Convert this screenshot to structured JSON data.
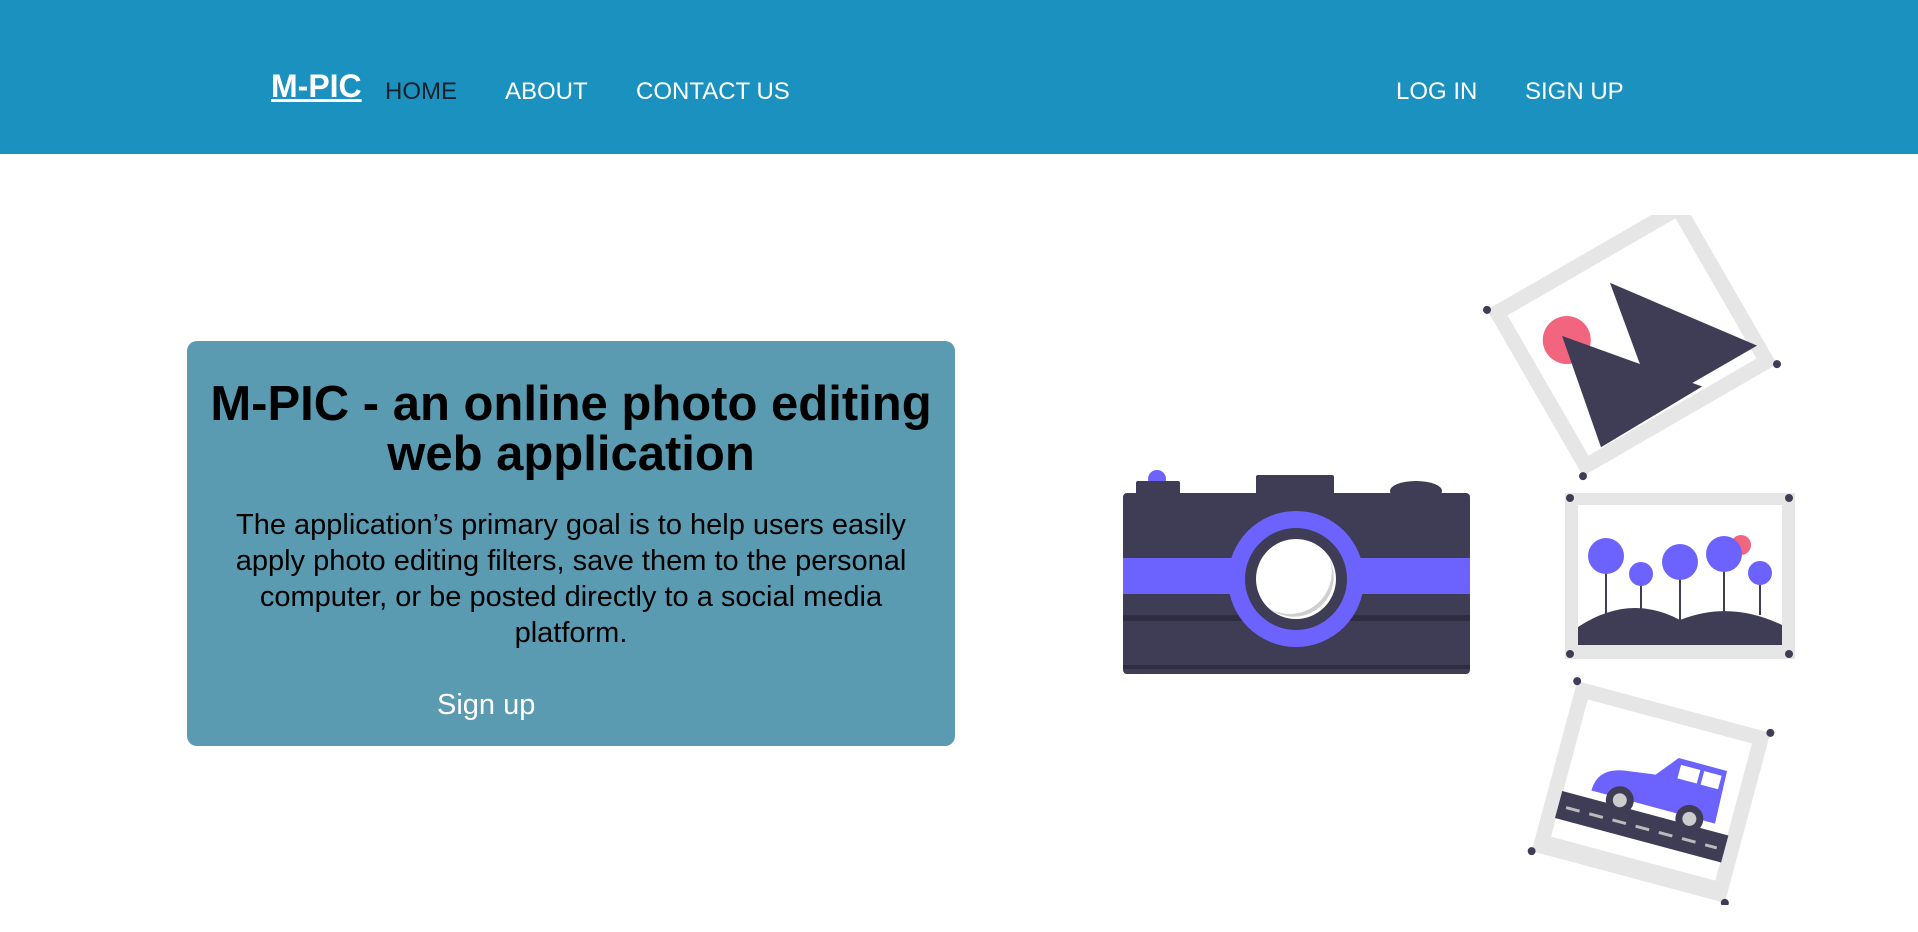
{
  "navbar": {
    "brand": "M-PIC",
    "links": [
      "HOME",
      "ABOUT",
      "CONTACT US"
    ],
    "auth": [
      "LOG IN",
      "SIGN UP"
    ]
  },
  "hero": {
    "title": "M-PIC - an online photo editing web application",
    "description": "The application’s primary goal is to help users easily apply photo editing filters, save them to the personal computer, or be posted directly to a social media platform.",
    "button_label": "Sign up"
  },
  "illustration": {
    "primary_color": "#6c63ff",
    "dark_color": "#3f3d56",
    "accent_color": "#f2657f",
    "frame_color": "#e6e6e6",
    "icons": [
      "camera-icon",
      "mountain-photo-icon",
      "trees-photo-icon",
      "car-photo-icon"
    ]
  }
}
